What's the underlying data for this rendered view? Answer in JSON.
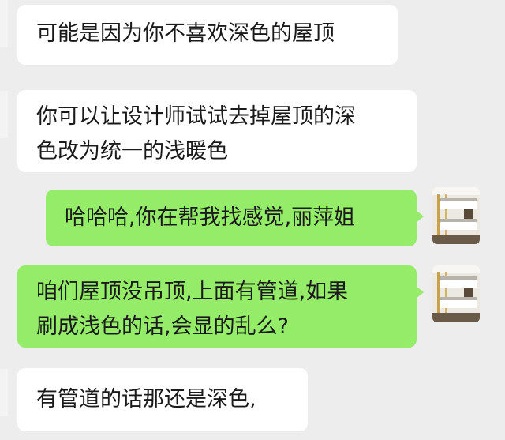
{
  "chat": {
    "messages": [
      {
        "side": "in",
        "lines": [
          "可能是因为你不喜欢深色的屋顶"
        ]
      },
      {
        "side": "in",
        "lines": [
          "你可以让设计师试试去掉屋顶的深",
          "色改为统一的浅暖色"
        ]
      },
      {
        "side": "out",
        "lines": [
          "哈哈哈,你在帮我找感觉,丽萍姐"
        ]
      },
      {
        "side": "out",
        "lines": [
          "咱们屋顶没吊顶,上面有管道,如果",
          "刷成浅色的话,会显的乱么?"
        ]
      },
      {
        "side": "in",
        "lines": [
          "有管道的话那还是深色,"
        ]
      }
    ]
  },
  "colors": {
    "background": "#ededed",
    "incoming_bubble": "#ffffff",
    "outgoing_bubble": "#95ec69"
  }
}
